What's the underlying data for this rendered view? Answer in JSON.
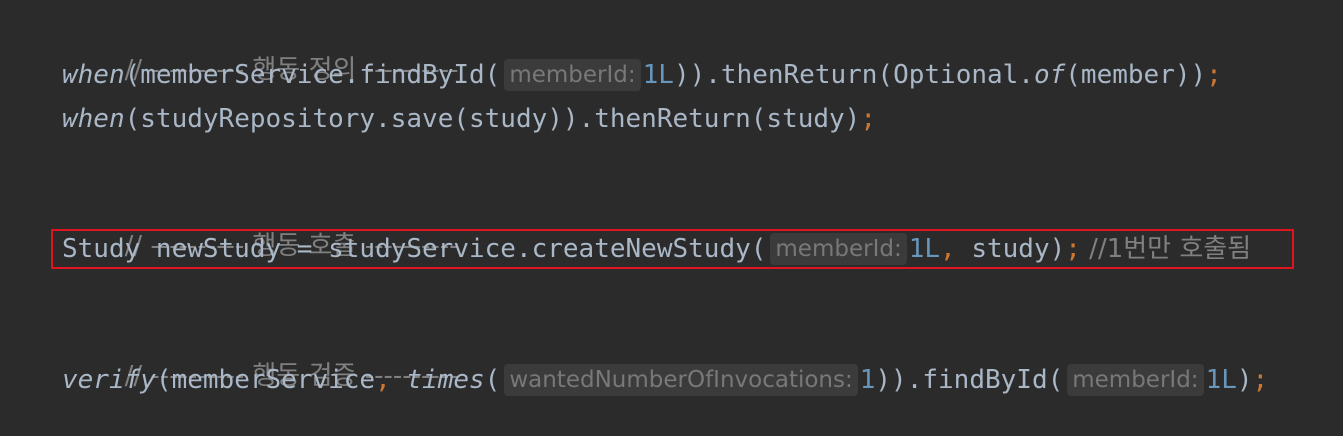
{
  "code": {
    "comment_define": "// ---------- 행동 정의 ----------",
    "line2": {
      "call": "when",
      "open": "(memberService.findById(",
      "hint_name": "memberId:",
      "arg": "1L",
      "rest_a": ")).thenReturn(Optional.",
      "of": "of",
      "rest_b": "(member))",
      "semi": ";"
    },
    "line3": {
      "call": "when",
      "rest": "(studyRepository.save(study)).thenReturn(study)",
      "semi": ";"
    },
    "comment_call": "// ---------- 행동 호출 ----------",
    "line6": {
      "code_a": "Study newStudy = studyService.createNewStudy(",
      "hint_name": "memberId:",
      "arg": "1L",
      "comma": ",",
      "code_b": " study)",
      "semi": ";",
      "trailing_comment": " //1번만 호출됨"
    },
    "comment_verify": "// ---------- 행동 검증 ----------",
    "line9": {
      "call": "verify",
      "open": "(memberService",
      "comma": ",",
      "times": "times",
      "paren": "(",
      "hint_name": "wantedNumberOfInvocations:",
      "arg": "1",
      "mid": ")).findById(",
      "hint_name2": "memberId:",
      "arg2": "1L",
      "close": ")",
      "semi": ";"
    }
  },
  "colors": {
    "background": "#2b2b2b",
    "text": "#a9b7c6",
    "comment": "#808080",
    "number": "#6897bb",
    "keyword_semicolon": "#cc7832",
    "highlight_border": "#e0141e"
  }
}
